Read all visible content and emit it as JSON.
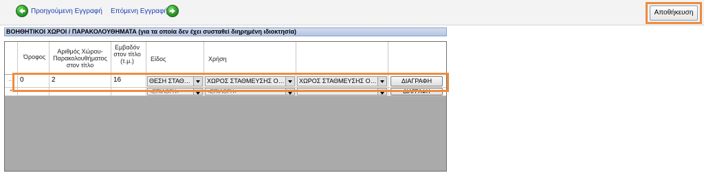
{
  "toolbar": {
    "prev_label": "Προηγούμενη Εγγραφή",
    "next_label": "Επόμενη Εγγραφή",
    "save_label": "Αποθήκευση"
  },
  "section": {
    "title": "ΒΟΗΘΗΤΙΚΟΙ ΧΩΡΟΙ / ΠΑΡΑΚΟΛΟΥΘΗΜΑΤΑ (για τα οποία δεν έχει συσταθεί διηρημένη ιδιοκτησία)"
  },
  "grid": {
    "columns": {
      "floor": "Όροφος",
      "number": "Αριθμός Χώρου-Παρακολουθήματος στον τίτλο",
      "area": "Εμβαδόν στον τίτλο (τ.μ.)",
      "type": "Είδος",
      "use": "Χρήση",
      "extra": ""
    },
    "rows": [
      {
        "indicator": "…",
        "floor": "0",
        "number": "2",
        "area": "16",
        "type": "ΘΕΣΗ ΣΤΑΘ…",
        "use": "ΧΩΡΟΣ ΣΤΑΘΜΕΥΣΗΣ Ο…",
        "extra": "ΧΩΡΟΣ ΣΤΑΘΜΕΥΣΗΣ Ο…",
        "action": "ΔΙΑΓΡΑΦΗ"
      },
      {
        "indicator": "*",
        "floor": "",
        "number": "",
        "area": "",
        "type": "<ΕΠΙΛΟΓΗ>",
        "use": "<ΕΠΙΛΟΓΗ>",
        "extra": "",
        "action": "ΔΙΑΓΡΑΦΗ"
      }
    ]
  },
  "colors": {
    "highlight": "#f08a3a",
    "section_header_bg": "#c4d0ea",
    "grid_empty_bg": "#aaaaaa",
    "link": "#1a3fb0"
  }
}
